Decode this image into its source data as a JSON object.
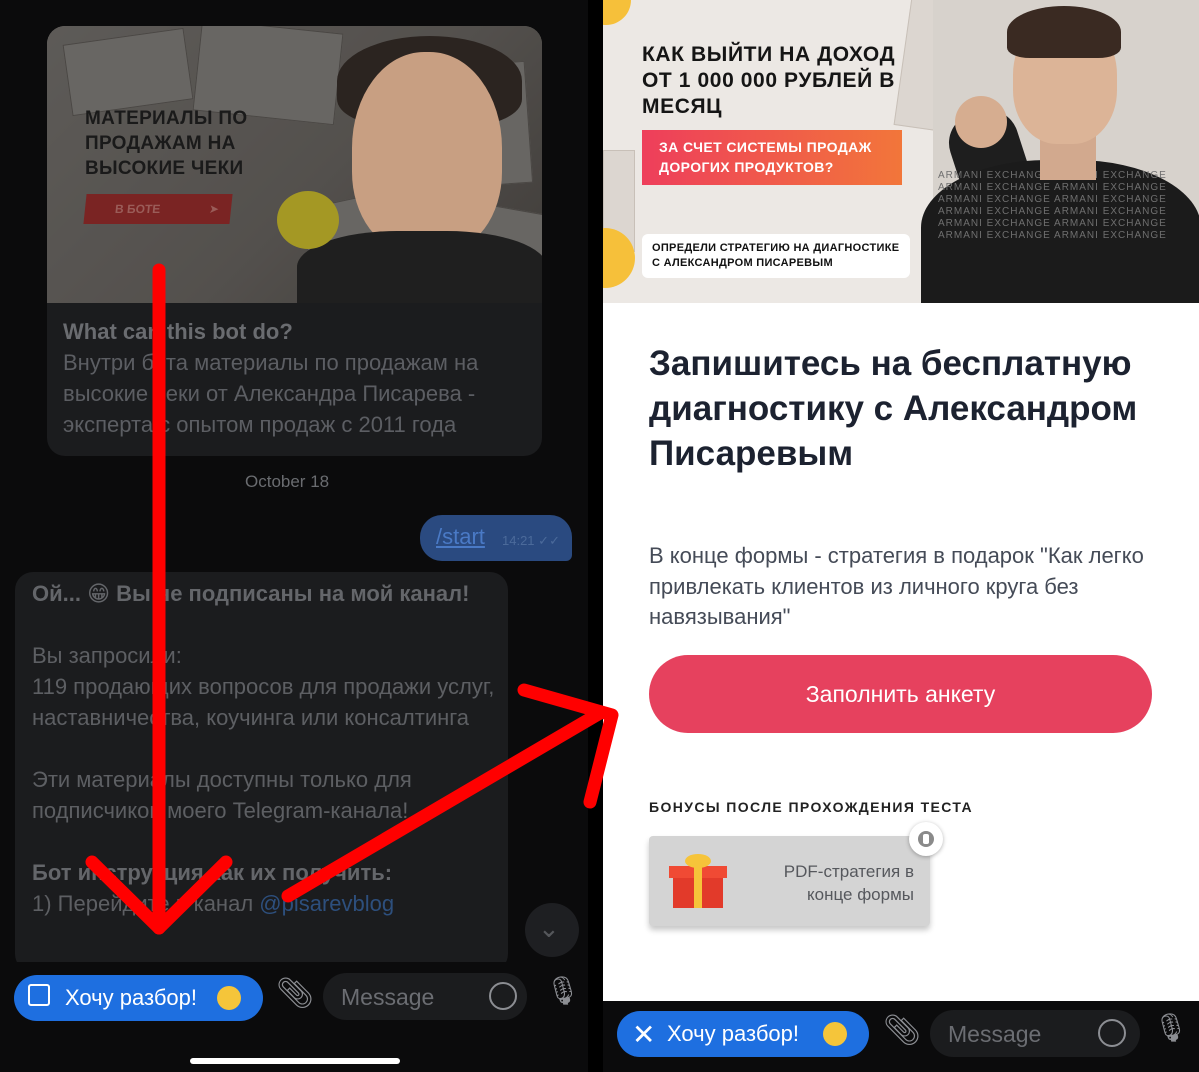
{
  "left": {
    "bot_banner": {
      "title": "МАТЕРИАЛЫ ПО ПРОДАЖАМ НА ВЫСОКИЕ ЧЕКИ",
      "button_label": "В БОТЕ"
    },
    "bot_info": {
      "title": "What can this bot do?",
      "description": "Внутри бота материалы по продажам на высокие чеки от Александра Писарева - эксперта с опытом продаж с 2011 года"
    },
    "date_divider": "October 18",
    "start_message": {
      "text": "/start",
      "time": "14:21"
    },
    "reply_message": {
      "line1": "Ой... 😁 Вы не подписаны на мой канал!",
      "para2": "Вы запросили:\n119 продающих вопросов для продажи услуг, наставничества, коучинга или консалтинга",
      "para3": "Эти материалы доступны только для подписчиков моего Telegram-канала!",
      "instr_title": "Бот инструкция как их получить:",
      "step1_prefix": "1) Перейдите в канал ",
      "step1_link": "@pisarevblog"
    },
    "keyboard_button": "Хочу разбор!",
    "message_placeholder": "Message"
  },
  "right": {
    "hero": {
      "headline": "КАК ВЫЙТИ НА ДОХОД ОТ 1 000 000 РУБЛЕЙ В МЕСЯЦ",
      "pill": "ЗА СЧЕТ СИСТЕМЫ ПРОДАЖ ДОРОГИХ ПРОДУКТОВ?",
      "note": "ОПРЕДЕЛИ СТРАТЕГИЮ НА ДИАГНОСТИКЕ С АЛЕКСАНДРОМ ПИСАРЕВЫМ",
      "shirt_text": "ARMANI EXCHANGE ARMANI EXCHANGE ARMANI EXCHANGE ARMANI EXCHANGE ARMANI EXCHANGE ARMANI EXCHANGE ARMANI EXCHANGE ARMANI EXCHANGE ARMANI EXCHANGE ARMANI EXCHANGE ARMANI EXCHANGE ARMANI EXCHANGE"
    },
    "form_title": "Запишитесь на бесплатную диагностику с Александром Писаревым",
    "form_subtitle": "В конце формы - стратегия в подарок \"Как легко привлекать клиентов из личного круга без навязывания\"",
    "cta_label": "Заполнить анкету",
    "bonus_heading": "БОНУСЫ ПОСЛЕ ПРОХОЖДЕНИЯ ТЕСТА",
    "bonus_item": "PDF-стратегия в конце формы",
    "keyboard_button": "Хочу разбор!",
    "message_placeholder": "Message"
  },
  "colors": {
    "telegram_blue": "#1e6fe0",
    "cta_red": "#e6415e",
    "annotation_red": "#ff0000",
    "title_navy": "#1c2230"
  },
  "icons": [
    "keyboard-icon",
    "close-icon",
    "emoji-star-struck-icon",
    "paperclip-icon",
    "sticker-icon",
    "microphone-icon",
    "chevron-down-icon",
    "telegram-plane-icon",
    "gift-icon",
    "lock-icon",
    "double-check-icon"
  ]
}
